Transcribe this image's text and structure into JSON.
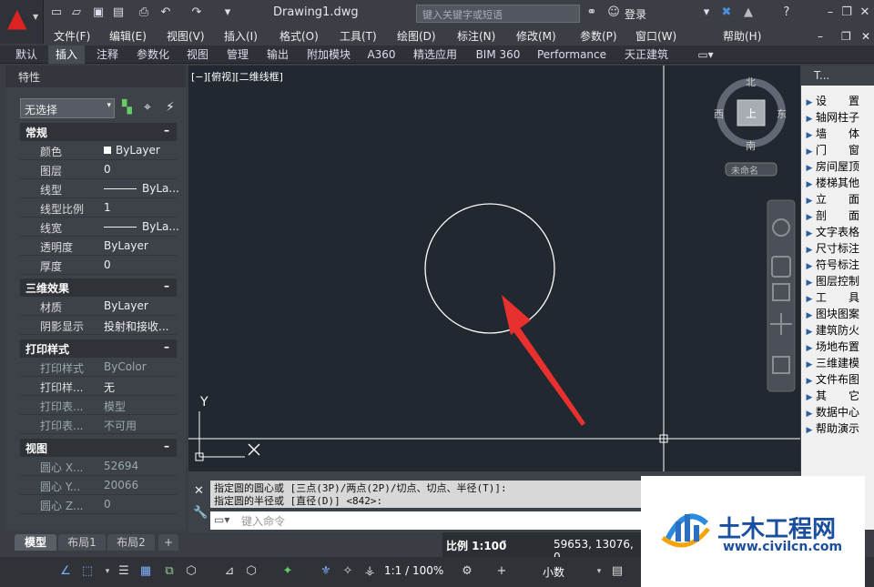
{
  "app": {
    "doc_title": "Drawing1.dwg",
    "search_placeholder": "键入关键字或短语",
    "user": "登录"
  },
  "menu": [
    "文件(F)",
    "编辑(E)",
    "视图(V)",
    "插入(I)",
    "格式(O)",
    "工具(T)",
    "绘图(D)",
    "标注(N)",
    "修改(M)",
    "参数(P)",
    "窗口(W)",
    "帮助(H)"
  ],
  "ribbon_tabs": [
    "默认",
    "插入",
    "注释",
    "参数化",
    "视图",
    "管理",
    "输出",
    "附加模块",
    "A360",
    "精选应用",
    "BIM 360",
    "Performance",
    "天正建筑"
  ],
  "ribbon_active": "插入",
  "properties": {
    "title": "特性",
    "selection": "无选择",
    "sections": [
      {
        "name": "常规",
        "rows": [
          [
            "颜色",
            "ByLayer"
          ],
          [
            "图层",
            "0"
          ],
          [
            "线型",
            "ByLa..."
          ],
          [
            "线型比例",
            "1"
          ],
          [
            "线宽",
            "ByLa..."
          ],
          [
            "透明度",
            "ByLayer"
          ],
          [
            "厚度",
            "0"
          ]
        ]
      },
      {
        "name": "三维效果",
        "rows": [
          [
            "材质",
            "ByLayer"
          ],
          [
            "阴影显示",
            "投射和接收..."
          ]
        ]
      },
      {
        "name": "打印样式",
        "rows": [
          [
            "打印样式",
            "ByColor"
          ],
          [
            "打印样...",
            "无"
          ],
          [
            "打印表...",
            "模型"
          ],
          [
            "打印表...",
            "不可用"
          ]
        ]
      },
      {
        "name": "视图",
        "rows": [
          [
            "圆心 X...",
            "52694"
          ],
          [
            "圆心 Y...",
            "20066"
          ],
          [
            "圆心 Z...",
            "0"
          ]
        ]
      }
    ]
  },
  "viewport": {
    "label": "[−][俯视][二维线框]",
    "compass": {
      "n": "北",
      "s": "南",
      "e": "东",
      "w": "西",
      "top": "上"
    },
    "ucs_name": "未命名",
    "axis_x": "X",
    "axis_y": "Y"
  },
  "command": {
    "line1": "指定圆的圆心或 [三点(3P)/两点(2P)/切点、切点、半径(T)]:",
    "line2": "指定圆的半径或 [直径(D)] <842>:",
    "placeholder": "键入命令"
  },
  "tianzheng": {
    "title": "T...",
    "items": [
      "设　　置",
      "轴网柱子",
      "墙　　体",
      "门　　窗",
      "房间屋顶",
      "楼梯其他",
      "立　　面",
      "剖　　面",
      "文字表格",
      "尺寸标注",
      "符号标注",
      "图层控制",
      "工　　具",
      "图块图案",
      "建筑防火",
      "场地布置",
      "三维建模",
      "文件布图",
      "其　　它",
      "数据中心",
      "帮助演示"
    ]
  },
  "layout_tabs": [
    "模型",
    "布局1",
    "布局2"
  ],
  "status": {
    "scale": "比例 1:100",
    "coords": "59653, 13076, 0",
    "anno_scale": "1:1 / 100%",
    "units": "小数"
  },
  "watermark": {
    "title": "土木工程网",
    "url": "www.civilcn.com"
  },
  "colors": {
    "canvas": "#212830",
    "arrow": "#e8302f",
    "accent": "#3b7bd6"
  }
}
